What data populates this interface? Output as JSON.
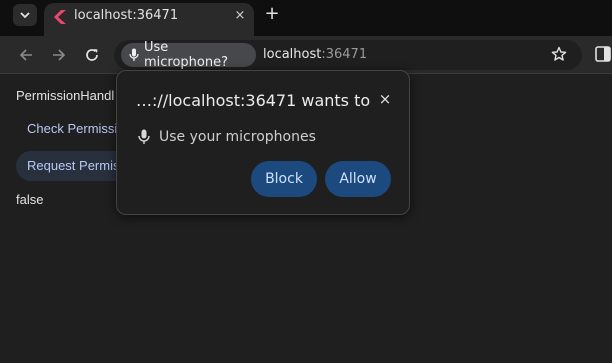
{
  "browser": {
    "tab": {
      "title": "localhost:36471",
      "close_glyph": "×"
    },
    "new_tab_glyph": "+",
    "omnibox": {
      "permission_chip_label": "Use microphone?",
      "url_host": "localhost",
      "url_port": ":36471"
    },
    "icons": {
      "tab_search": "chevron-down-icon",
      "back": "arrow-left-icon",
      "forward": "arrow-right-icon",
      "reload": "reload-icon",
      "mic": "microphone-icon",
      "bookmark": "star-icon",
      "side_panel": "side-panel-icon"
    }
  },
  "page": {
    "title": "PermissionHandl",
    "check_button_label": "Check Permissi",
    "request_button_label": "Request Permis",
    "result_text": "false"
  },
  "permission_popup": {
    "title": "…://localhost:36471 wants to",
    "close_glyph": "×",
    "permission_label": "Use your microphones",
    "block_label": "Block",
    "allow_label": "Allow"
  },
  "colors": {
    "background": "#1f1f1f",
    "toolbar": "#2a2a2a",
    "popup_button": "#1c4a7e",
    "link_text": "#b9c8f5"
  }
}
